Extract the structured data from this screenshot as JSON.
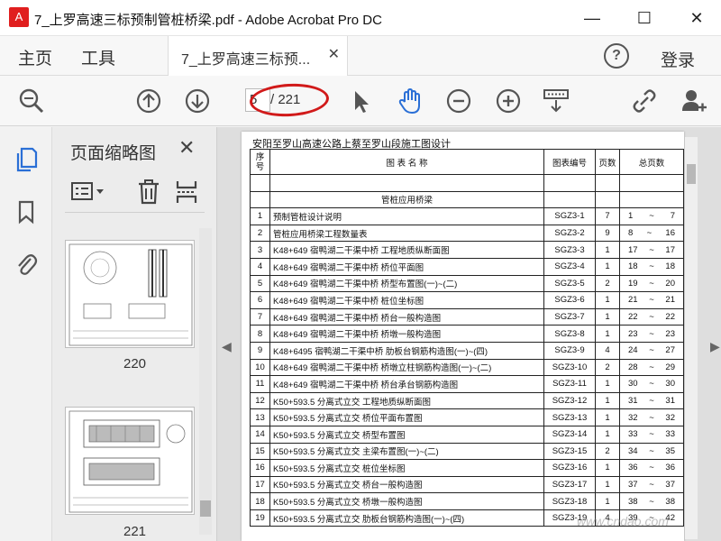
{
  "window": {
    "title": "7_上罗高速三标预制管桩桥梁.pdf - Adobe Acrobat Pro DC",
    "minimize": "—",
    "maximize": "☐",
    "close": "✕"
  },
  "menu": {
    "home": "主页",
    "tools": "工具",
    "tab_label": "7_上罗高速三标预...",
    "tab_close": "✕",
    "help": "?",
    "login": "登录"
  },
  "toolbar": {
    "page_current": "5",
    "page_total": "/ 221",
    "icons": [
      "search-zoom-icon",
      "page-up-icon",
      "page-down-icon",
      "select-cursor-icon",
      "hand-tool-icon",
      "zoom-out-icon",
      "zoom-in-icon",
      "keyboard-scroll-icon",
      "share-link-icon",
      "add-user-icon"
    ]
  },
  "thumbnails_panel": {
    "title": "页面缩略图",
    "close": "✕",
    "pages": [
      {
        "label": "220"
      },
      {
        "label": "221"
      }
    ]
  },
  "document": {
    "heading": "安阳至罗山高速公路上蔡至罗山段施工图设计",
    "columns": {
      "no": "序\n号",
      "name": "图 表 名 称",
      "code": "图表编号",
      "pages": "页数",
      "total": "总页数"
    },
    "section_title": "管桩应用桥梁",
    "tilde": "~",
    "rows": [
      {
        "no": "1",
        "name": "预制管桩设计说明",
        "code": "SGZ3-1",
        "pages": "7",
        "from": "1",
        "to": "7"
      },
      {
        "no": "2",
        "name": "管桩应用桥梁工程数量表",
        "code": "SGZ3-2",
        "pages": "9",
        "from": "8",
        "to": "16"
      },
      {
        "no": "3",
        "name": "K48+649 宿鸭湖二干渠中桥 工程地质纵断面图",
        "code": "SGZ3-3",
        "pages": "1",
        "from": "17",
        "to": "17"
      },
      {
        "no": "4",
        "name": "K48+649 宿鸭湖二干渠中桥 桥位平面图",
        "code": "SGZ3-4",
        "pages": "1",
        "from": "18",
        "to": "18"
      },
      {
        "no": "5",
        "name": "K48+649 宿鸭湖二干渠中桥 桥型布置图(一)~(二)",
        "code": "SGZ3-5",
        "pages": "2",
        "from": "19",
        "to": "20"
      },
      {
        "no": "6",
        "name": "K48+649 宿鸭湖二干渠中桥 桩位坐标图",
        "code": "SGZ3-6",
        "pages": "1",
        "from": "21",
        "to": "21"
      },
      {
        "no": "7",
        "name": "K48+649 宿鸭湖二干渠中桥 桥台一般构造图",
        "code": "SGZ3-7",
        "pages": "1",
        "from": "22",
        "to": "22"
      },
      {
        "no": "8",
        "name": "K48+649 宿鸭湖二干渠中桥 桥墩一般构造图",
        "code": "SGZ3-8",
        "pages": "1",
        "from": "23",
        "to": "23"
      },
      {
        "no": "9",
        "name": "K48+6495 宿鸭湖二干渠中桥 肋板台钢筋构造图(一)~(四)",
        "code": "SGZ3-9",
        "pages": "4",
        "from": "24",
        "to": "27"
      },
      {
        "no": "10",
        "name": "K48+649 宿鸭湖二干渠中桥 桥墩立柱钢筋构造图(一)~(二)",
        "code": "SGZ3-10",
        "pages": "2",
        "from": "28",
        "to": "29"
      },
      {
        "no": "11",
        "name": "K48+649 宿鸭湖二干渠中桥 桥台承台钢筋构造图",
        "code": "SGZ3-11",
        "pages": "1",
        "from": "30",
        "to": "30"
      },
      {
        "no": "12",
        "name": "K50+593.5 分离式立交 工程地质纵断面图",
        "code": "SGZ3-12",
        "pages": "1",
        "from": "31",
        "to": "31"
      },
      {
        "no": "13",
        "name": "K50+593.5 分离式立交 桥位平面布置图",
        "code": "SGZ3-13",
        "pages": "1",
        "from": "32",
        "to": "32"
      },
      {
        "no": "14",
        "name": "K50+593.5 分离式立交 桥型布置图",
        "code": "SGZ3-14",
        "pages": "1",
        "from": "33",
        "to": "33"
      },
      {
        "no": "15",
        "name": "K50+593.5 分离式立交 主梁布置图(一)~(二)",
        "code": "SGZ3-15",
        "pages": "2",
        "from": "34",
        "to": "35"
      },
      {
        "no": "16",
        "name": "K50+593.5 分离式立交 桩位坐标图",
        "code": "SGZ3-16",
        "pages": "1",
        "from": "36",
        "to": "36"
      },
      {
        "no": "17",
        "name": "K50+593.5 分离式立交 桥台一般构造图",
        "code": "SGZ3-17",
        "pages": "1",
        "from": "37",
        "to": "37"
      },
      {
        "no": "18",
        "name": "K50+593.5 分离式立交 桥墩一般构造图",
        "code": "SGZ3-18",
        "pages": "1",
        "from": "38",
        "to": "38"
      },
      {
        "no": "19",
        "name": "K50+593.5 分离式立交 肋板台钢筋构造图(一)~(四)",
        "code": "SGZ3-19",
        "pages": "4",
        "from": "39",
        "to": "42"
      }
    ]
  },
  "watermark": "www.cndao.com"
}
